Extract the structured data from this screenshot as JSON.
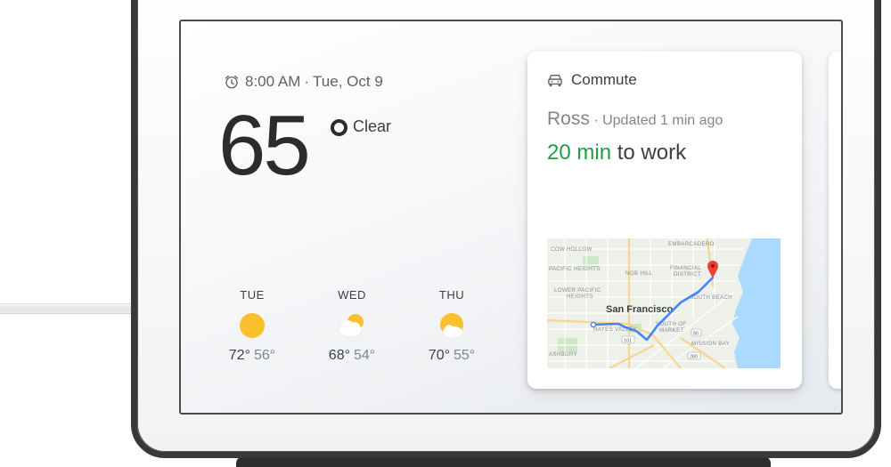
{
  "device": {
    "name": "Google Home Hub"
  },
  "weather": {
    "time": "8:00 AM",
    "date": "Tue, Oct 9",
    "separator": "·",
    "temperature": "65",
    "condition": "Clear",
    "forecast": [
      {
        "day": "TUE",
        "icon": "sunny-icon",
        "high": "72°",
        "low": "56°"
      },
      {
        "day": "WED",
        "icon": "partly-cloudy-icon",
        "high": "68°",
        "low": "54°"
      },
      {
        "day": "THU",
        "icon": "mostly-sunny-icon",
        "high": "70°",
        "low": "55°"
      }
    ]
  },
  "commute": {
    "title": "Commute",
    "person": "Ross",
    "updated": "· Updated 1 min ago",
    "eta": "20 min",
    "destination": "to work",
    "map": {
      "labels": {
        "cow_hollow": "COW HOLLOW",
        "embarcadero": "EMBARCADERO",
        "pacific_heights": "PACIFIC HEIGHTS",
        "nob_hill": "NOB HILL",
        "financial": "FINANCIAL",
        "district": "DISTRICT",
        "lower_pacific": "LOWER PACIFIC",
        "heights": "HEIGHTS",
        "south_beach": "SOUTH BEACH",
        "san_francisco": "San Francisco",
        "hayes_valley": "HAYES VALLEY",
        "south_of": "SOUTH OF",
        "market": "MARKET",
        "mission_bay": "MISSION BAY",
        "ashbury": "ASHBURY",
        "hwy_101": "101",
        "hwy_80": "80",
        "hwy_280": "280"
      },
      "route_color": "#4285f4",
      "pin_color": "#ea4335",
      "water_color": "#aadaff"
    }
  },
  "colors": {
    "eta_green": "#1e9e45",
    "text_dark": "#3c4043",
    "text_muted": "#80868b",
    "sun_yellow": "#fbc02d"
  }
}
